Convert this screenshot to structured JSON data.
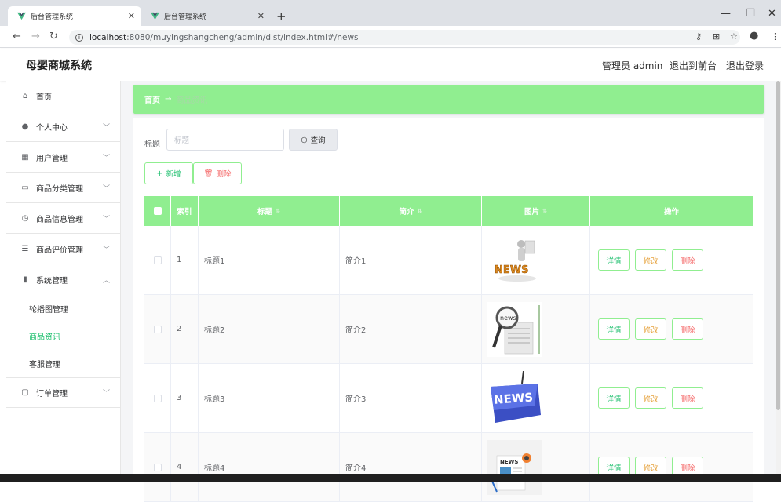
{
  "browser": {
    "tabs": [
      {
        "title": "后台管理系统",
        "active": true
      },
      {
        "title": "后台管理系统",
        "active": false
      }
    ],
    "new_tab": "+",
    "url_host": "localhost",
    "url_path": ":8080/muyingshangcheng/admin/dist/index.html#/news"
  },
  "header": {
    "logo": "母婴商城系统",
    "admin": "管理员 admin",
    "to_front": "退出到前台",
    "logout": "退出登录"
  },
  "sidebar": {
    "items": [
      {
        "label": "首页",
        "icon": "home-icon",
        "expandable": false
      },
      {
        "label": "个人中心",
        "icon": "user-icon",
        "expandable": true
      },
      {
        "label": "用户管理",
        "icon": "grid-icon",
        "expandable": true
      },
      {
        "label": "商品分类管理",
        "icon": "card-icon",
        "expandable": true
      },
      {
        "label": "商品信息管理",
        "icon": "clock-icon",
        "expandable": true
      },
      {
        "label": "商品评价管理",
        "icon": "sliders-icon",
        "expandable": true
      },
      {
        "label": "系统管理",
        "icon": "chart-icon",
        "expandable": true,
        "expanded": true
      },
      {
        "label": "订单管理",
        "icon": "chat-icon",
        "expandable": true
      }
    ],
    "submenu": [
      "轮播图管理",
      "商品资讯",
      "客服管理"
    ],
    "active_sub": "商品资讯"
  },
  "breadcrumb": {
    "home": "首页",
    "sep": "→",
    "current": "商品资讯"
  },
  "search": {
    "label": "标题",
    "placeholder": "标题",
    "button": "查询"
  },
  "actions": {
    "add": "新增",
    "delete": "删除"
  },
  "table": {
    "headers": {
      "index": "索引",
      "title": "标题",
      "intro": "简介",
      "image": "图片",
      "ops": "操作"
    },
    "rows": [
      {
        "index": "1",
        "title": "标题1",
        "intro": "简介1",
        "image": "news-3d-figure"
      },
      {
        "index": "2",
        "title": "标题2",
        "intro": "简介2",
        "image": "news-magnifier"
      },
      {
        "index": "3",
        "title": "标题3",
        "intro": "简介3",
        "image": "news-keyboard-key"
      },
      {
        "index": "4",
        "title": "标题4",
        "intro": "简介4",
        "image": "news-paper"
      }
    ],
    "ops": {
      "detail": "详情",
      "edit": "修改",
      "delete": "删除"
    }
  },
  "colors": {
    "accent": "#90ee90",
    "primary_text": "#19be6b",
    "danger": "#f56c6c",
    "warning": "#e6a23c"
  }
}
